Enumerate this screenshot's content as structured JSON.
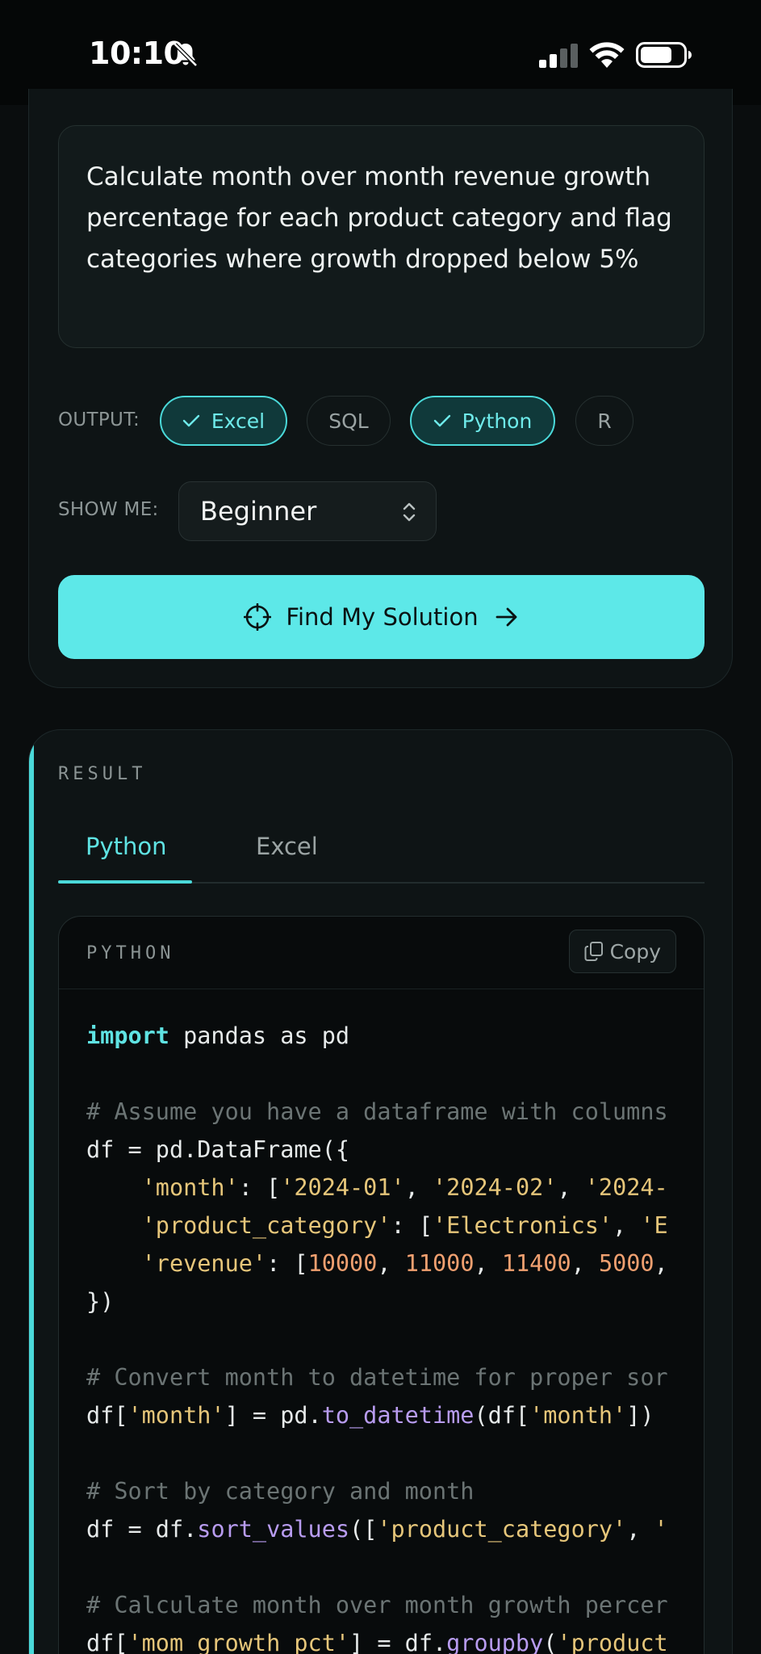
{
  "status_bar": {
    "time": "10:10"
  },
  "query": {
    "text": "Calculate month over month revenue growth percentage for each product category and flag categories where growth dropped below 5%"
  },
  "output": {
    "label": "OUTPUT:",
    "options": [
      {
        "label": "Excel",
        "selected": true
      },
      {
        "label": "SQL",
        "selected": false
      },
      {
        "label": "Python",
        "selected": true
      },
      {
        "label": "R",
        "selected": false
      }
    ]
  },
  "show_me": {
    "label": "SHOW ME:",
    "value": "Beginner"
  },
  "find_button": {
    "label": "Find My Solution"
  },
  "result": {
    "label": "RESULT",
    "tabs": [
      {
        "label": "Python",
        "active": true
      },
      {
        "label": "Excel",
        "active": false
      }
    ],
    "code": {
      "language": "PYTHON",
      "copy_label": "Copy",
      "lines": [
        [
          {
            "t": "import",
            "c": "kw"
          },
          {
            "t": " pandas as pd",
            "c": ""
          }
        ],
        [],
        [
          {
            "t": "# Assume you have a dataframe with columns",
            "c": "cm"
          }
        ],
        [
          {
            "t": "df = pd.DataFrame({",
            "c": ""
          }
        ],
        [
          {
            "t": "    ",
            "c": ""
          },
          {
            "t": "'month'",
            "c": "st"
          },
          {
            "t": ": [",
            "c": ""
          },
          {
            "t": "'2024-01'",
            "c": "st"
          },
          {
            "t": ", ",
            "c": ""
          },
          {
            "t": "'2024-02'",
            "c": "st"
          },
          {
            "t": ", ",
            "c": ""
          },
          {
            "t": "'2024-",
            "c": "st"
          }
        ],
        [
          {
            "t": "    ",
            "c": ""
          },
          {
            "t": "'product_category'",
            "c": "st"
          },
          {
            "t": ": [",
            "c": ""
          },
          {
            "t": "'Electronics'",
            "c": "st"
          },
          {
            "t": ", ",
            "c": ""
          },
          {
            "t": "'E",
            "c": "st"
          }
        ],
        [
          {
            "t": "    ",
            "c": ""
          },
          {
            "t": "'revenue'",
            "c": "st"
          },
          {
            "t": ": [",
            "c": ""
          },
          {
            "t": "10000",
            "c": "nm"
          },
          {
            "t": ", ",
            "c": ""
          },
          {
            "t": "11000",
            "c": "nm"
          },
          {
            "t": ", ",
            "c": ""
          },
          {
            "t": "11400",
            "c": "nm"
          },
          {
            "t": ", ",
            "c": ""
          },
          {
            "t": "5000",
            "c": "nm"
          },
          {
            "t": ",",
            "c": ""
          }
        ],
        [
          {
            "t": "})",
            "c": ""
          }
        ],
        [],
        [
          {
            "t": "# Convert month to datetime for proper sor",
            "c": "cm"
          }
        ],
        [
          {
            "t": "df[",
            "c": ""
          },
          {
            "t": "'month'",
            "c": "st"
          },
          {
            "t": "] = pd.",
            "c": ""
          },
          {
            "t": "to_datetime",
            "c": "fn"
          },
          {
            "t": "(df[",
            "c": ""
          },
          {
            "t": "'month'",
            "c": "st"
          },
          {
            "t": "])",
            "c": ""
          }
        ],
        [],
        [
          {
            "t": "# Sort by category and month",
            "c": "cm"
          }
        ],
        [
          {
            "t": "df = df.",
            "c": ""
          },
          {
            "t": "sort_values",
            "c": "fn"
          },
          {
            "t": "([",
            "c": ""
          },
          {
            "t": "'product_category'",
            "c": "st"
          },
          {
            "t": ", ",
            "c": ""
          },
          {
            "t": "'",
            "c": "st"
          }
        ],
        [],
        [
          {
            "t": "# Calculate month over month growth percer",
            "c": "cm"
          }
        ],
        [
          {
            "t": "df[",
            "c": ""
          },
          {
            "t": "'mom_growth_pct'",
            "c": "st"
          },
          {
            "t": "] = df.",
            "c": ""
          },
          {
            "t": "groupby",
            "c": "fn"
          },
          {
            "t": "(",
            "c": ""
          },
          {
            "t": "'product",
            "c": "st"
          }
        ]
      ]
    }
  },
  "colors": {
    "accent": "#5de8e8",
    "background": "#0a0d0e",
    "card": "#0e1415"
  }
}
